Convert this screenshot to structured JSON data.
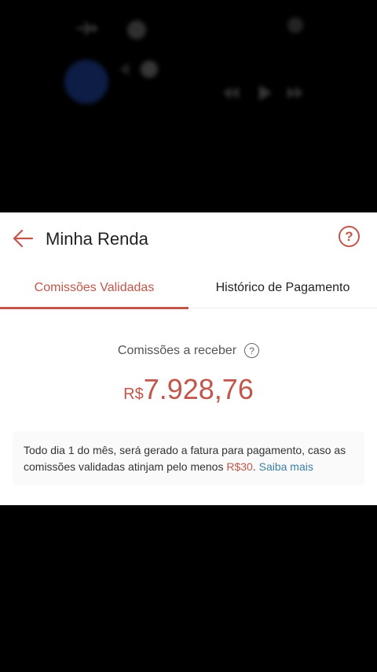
{
  "header": {
    "title": "Minha Renda",
    "help_icon": "?"
  },
  "tabs": [
    {
      "label": "Comissões Validadas",
      "active": true
    },
    {
      "label": "Histórico de Pagamento",
      "active": false
    }
  ],
  "balance": {
    "label": "Comissões a receber",
    "help_icon": "?",
    "currency": "R$",
    "value": "7.928,76"
  },
  "info": {
    "text_before": "Todo dia 1 do mês, será gerado a fatura para pagamento, caso as comissões validadas atinjam pelo menos ",
    "min_amount": "R$30",
    "text_after": ". ",
    "link": "Saiba mais"
  },
  "colors": {
    "accent": "#c0574a",
    "link": "#3d7fa3",
    "background": "#000000"
  }
}
